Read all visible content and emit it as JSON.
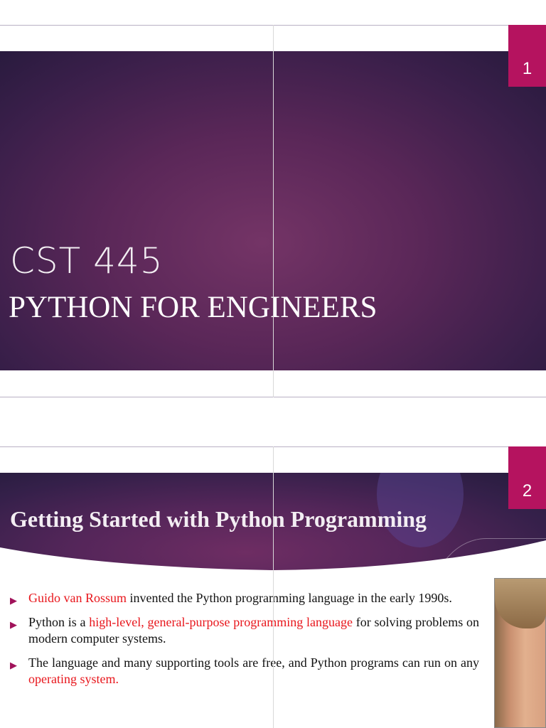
{
  "slide1": {
    "number": "1",
    "course_code": "CST 445",
    "course_title": "PYTHON FOR ENGINEERS"
  },
  "slide2": {
    "number": "2",
    "title": "Getting Started with Python Programming",
    "bullets": [
      {
        "highlight": "Guido van Rossum",
        "text": " invented the Python programming language in the early 1990s."
      },
      {
        "pre": "Python is a ",
        "highlight": "high-level, general-purpose programming language",
        "text": " for solving problems on modern computer systems."
      },
      {
        "pre": "The language and many supporting tools are free, and Python programs can run on any ",
        "highlight": "operating system."
      }
    ]
  },
  "colors": {
    "accent": "#b5135f",
    "highlight": "#e8161c",
    "band": "#5a2758"
  }
}
